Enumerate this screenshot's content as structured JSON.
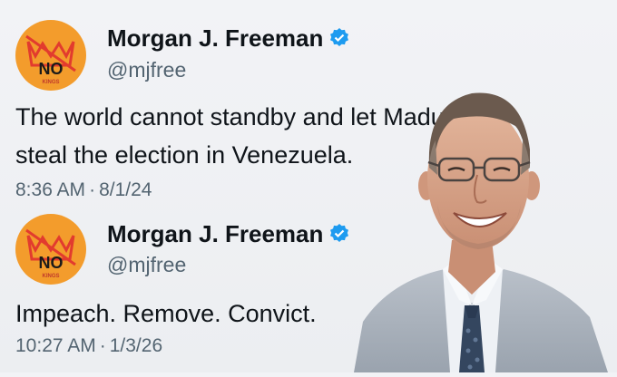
{
  "tweets": [
    {
      "display_name": "Morgan J. Freeman",
      "handle": "@mjfree",
      "text_lines": [
        "The world cannot standby and let Maduro",
        "steal the election in Venezuela."
      ],
      "time": "8:36 AM",
      "date": "8/1/24",
      "avatar": {
        "icon": "no-kings-logo",
        "main_text": "NO",
        "sub_text": "KINGS"
      }
    },
    {
      "display_name": "Morgan J. Freeman",
      "handle": "@mjfree",
      "text_lines": [
        "Impeach.  Remove.  Convict."
      ],
      "time": "10:27 AM",
      "date": "1/3/26",
      "avatar": {
        "icon": "no-kings-logo",
        "main_text": "NO",
        "sub_text": "KINGS"
      }
    }
  ],
  "icons": {
    "verified": "verified-badge-icon",
    "photo": "man-in-suit-photo"
  },
  "colors": {
    "avatar_bg": "#f39c2c",
    "crown": "#e23b2e",
    "verified": "#1d9bf0",
    "muted": "#536471"
  }
}
